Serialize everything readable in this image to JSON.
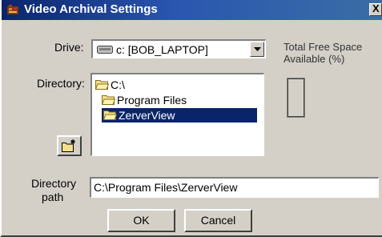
{
  "window": {
    "title": "Video Archival Settings",
    "close_label": "X"
  },
  "drive": {
    "label": "Drive:",
    "selected": "c: [BOB_LAPTOP]"
  },
  "free_space": {
    "label": "Total Free Space Available (%)",
    "value_percent": 0
  },
  "directory": {
    "label": "Directory:",
    "items": [
      {
        "name": "C:\\",
        "level": 0,
        "icon": "folder-open-icon",
        "selected": false
      },
      {
        "name": "Program Files",
        "level": 1,
        "icon": "folder-open-icon",
        "selected": false
      },
      {
        "name": "ZerverView",
        "level": 1,
        "icon": "folder-open-icon",
        "selected": true
      }
    ]
  },
  "new_folder": {
    "icon": "new-folder-icon"
  },
  "path": {
    "label_line1": "Directory",
    "label_line2": "path",
    "value": "C:\\Program Files\\ZerverView"
  },
  "buttons": {
    "ok": "OK",
    "cancel": "Cancel"
  },
  "colors": {
    "titlebar_start": "#0a246a",
    "titlebar_end": "#3a6ea5",
    "selection": "#0a246a",
    "face": "#d4d0c8"
  }
}
